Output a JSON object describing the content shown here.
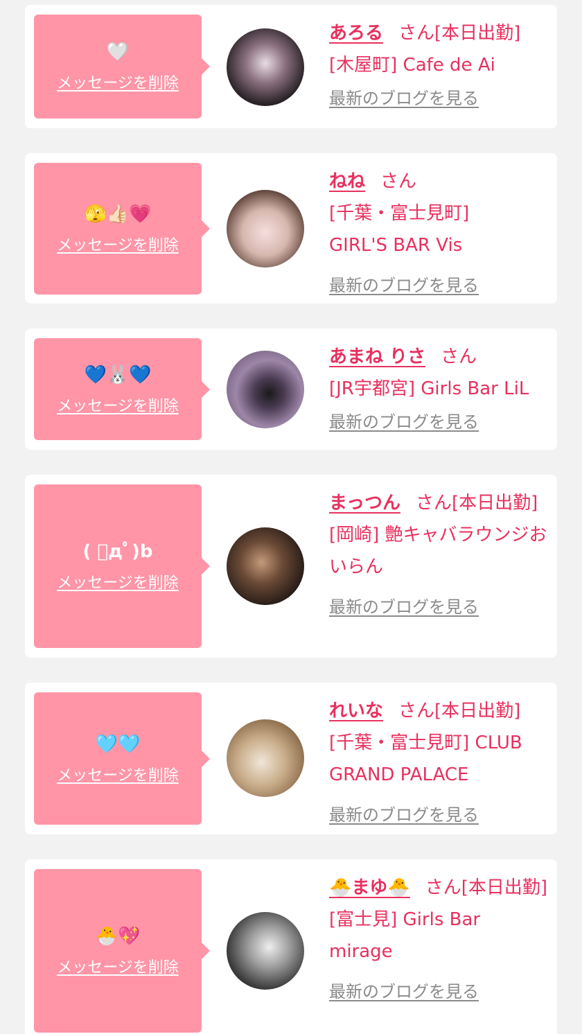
{
  "common": {
    "delete_label": "メッセージを削除",
    "blog_label": "最新のブログを見る",
    "san": "さん"
  },
  "colors": {
    "background": "#f2f2f2",
    "card": "#ffffff",
    "bubble": "#ff95a7",
    "accent": "#e8305e",
    "link_gray": "#8a8a8a"
  },
  "entries": [
    {
      "message": "🤍",
      "name": "あろる",
      "status": "[本日出勤]",
      "shop": "[木屋町] Cafe de Ai",
      "avatar": "avatar-photo"
    },
    {
      "message": "🫣👍🏻💗",
      "name": "ねね",
      "status": "",
      "shop": "[千葉・富士見町] GIRL'S BAR Vis",
      "avatar": "avatar-photo"
    },
    {
      "message": "💙🐰💙",
      "name": "あまね りさ",
      "status": "",
      "shop": "[JR宇都宮] Girls Bar LiL",
      "avatar": "avatar-photo"
    },
    {
      "message": "( ﾟдﾟ)b",
      "name": "まっつん",
      "status": "[本日出勤]",
      "shop": "[岡崎] 艶キャバラウンジおいらん",
      "avatar": "avatar-photo"
    },
    {
      "message": "🩵🩵",
      "name": "れいな",
      "status": "[本日出勤]",
      "shop": "[千葉・富士見町] CLUB GRAND PALACE",
      "avatar": "avatar-photo"
    },
    {
      "message": "🐣💖",
      "name": "🐣まゆ🐣",
      "status": "[本日出勤]",
      "shop": "[富士見] Girls Bar mirage",
      "avatar": "avatar-photo"
    }
  ]
}
